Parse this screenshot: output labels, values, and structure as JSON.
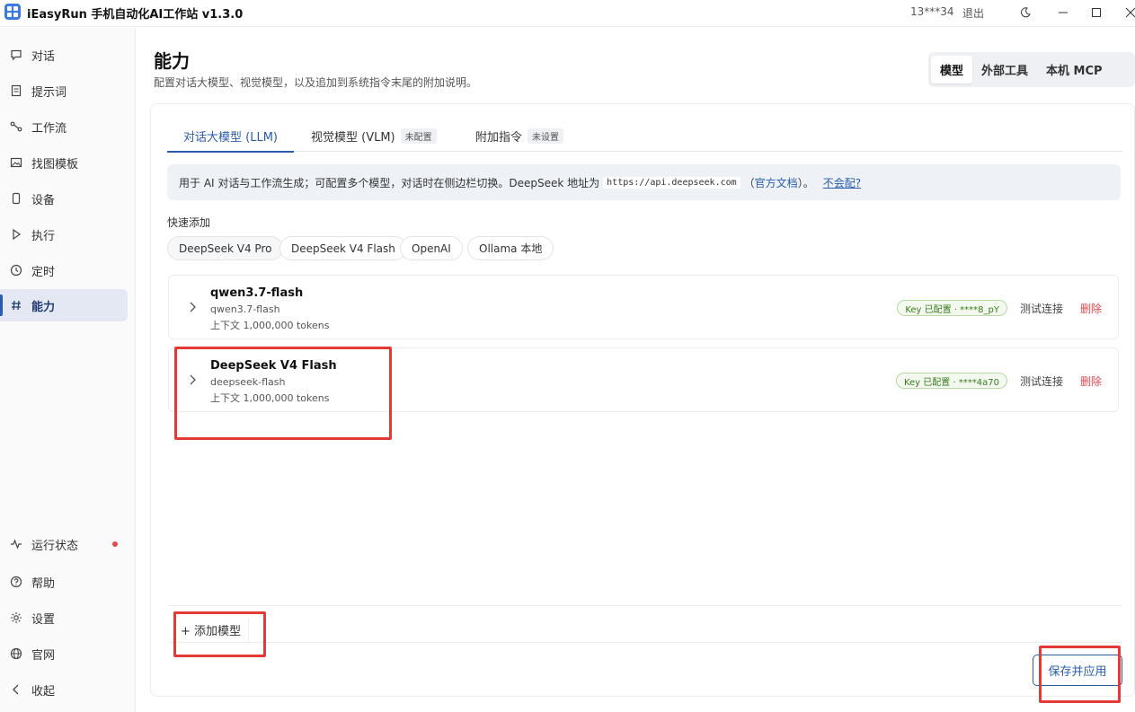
{
  "titlebar": {
    "app_title": "iEasyRun 手机自动化AI工作站 v1.3.0",
    "user": "13***34",
    "logout": "退出",
    "theme_icon": "moon-icon",
    "minimize_icon": "minimize-icon",
    "maximize_icon": "maximize-icon",
    "close_icon": "close-icon"
  },
  "sidebar": {
    "items": [
      {
        "label": "对话",
        "icon": "chat-icon"
      },
      {
        "label": "提示词",
        "icon": "document-icon"
      },
      {
        "label": "工作流",
        "icon": "workflow-icon"
      },
      {
        "label": "找图模板",
        "icon": "image-icon"
      },
      {
        "label": "设备",
        "icon": "phone-icon"
      },
      {
        "label": "执行",
        "icon": "play-icon"
      },
      {
        "label": "定时",
        "icon": "clock-icon"
      },
      {
        "label": "能力",
        "icon": "hash-icon",
        "active": true
      }
    ],
    "bottom": [
      {
        "label": "运行状态",
        "icon": "activity-icon"
      },
      {
        "label": "帮助",
        "icon": "help-icon"
      },
      {
        "label": "设置",
        "icon": "gear-icon"
      },
      {
        "label": "官网",
        "icon": "globe-icon"
      },
      {
        "label": "收起",
        "icon": "chevron-left-icon"
      }
    ],
    "status_dot_color": "#e5484d"
  },
  "page": {
    "title": "能力",
    "subtitle": "配置对话大模型、视觉模型，以及追加到系统指令末尾的附加说明。"
  },
  "segments": [
    {
      "label": "模型",
      "active": true
    },
    {
      "label": "外部工具"
    },
    {
      "label": "本机 MCP"
    }
  ],
  "tabs": [
    {
      "label": "对话大模型 (LLM)",
      "active": true,
      "badge": ""
    },
    {
      "label": "视觉模型 (VLM)",
      "badge": "未配置"
    },
    {
      "label": "附加指令",
      "badge": "未设置"
    }
  ],
  "info": {
    "text": "用于 AI 对话与工作流生成；可配置多个模型，对话时在侧边栏切换。DeepSeek 地址为",
    "url": "https://api.deepseek.com",
    "paren_open": "（",
    "docs_link": "官方文档",
    "paren_close": "）。",
    "help_link": "不会配?"
  },
  "quick_add": {
    "label": "快速添加",
    "options": [
      "DeepSeek V4 Pro",
      "DeepSeek V4 Flash",
      "OpenAI",
      "Ollama 本地"
    ]
  },
  "models": [
    {
      "name": "qwen3.7-flash",
      "id": "qwen3.7-flash",
      "context": "上下文 1,000,000 tokens",
      "key_badge": "Key 已配置 · ****8_pY",
      "test": "测试连接",
      "delete": "删除"
    },
    {
      "name": "DeepSeek V4 Flash",
      "id": "deepseek-flash",
      "context": "上下文 1,000,000 tokens",
      "key_badge": "Key 已配置 · ****4a70",
      "test": "测试连接",
      "delete": "删除"
    }
  ],
  "actions": {
    "add_model": "+ 添加模型",
    "save_apply": "保存并应用"
  },
  "colors": {
    "accent": "#2b5cab",
    "danger": "#e5484d",
    "highlight": "#e53935",
    "key_badge_bg": "#f3f9ee",
    "key_badge_text": "#3a7a1f"
  }
}
